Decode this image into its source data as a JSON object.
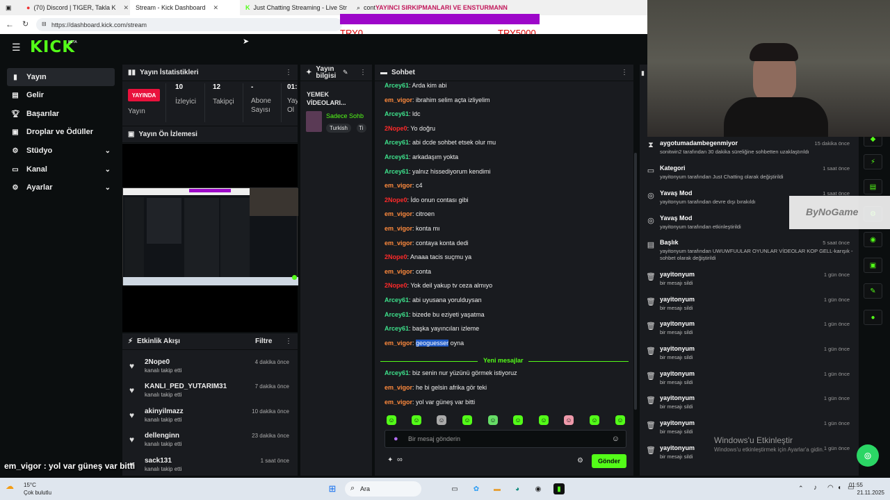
{
  "browser": {
    "tabs": [
      {
        "label": "(70) Discord | TIGER, Takla K",
        "active": false
      },
      {
        "label": "Stream - Kick Dashboard",
        "active": true
      },
      {
        "label": "Just Chatting Streaming - Live Str",
        "active": false
      },
      {
        "label": "cont",
        "active": false
      }
    ],
    "url": "https://dashboard.kick.com/stream"
  },
  "overlay": {
    "title": "YAYINCI SIRKIPMANLARI VE ENSTURMANN",
    "min": "TRY0",
    "max": "TRY5000"
  },
  "header": {
    "logo": "KICK",
    "badge": "BETA"
  },
  "sidebar": {
    "items": [
      {
        "label": "Yayın",
        "icon": "broadcast-icon",
        "selected": true
      },
      {
        "label": "Gelir",
        "icon": "money-icon"
      },
      {
        "label": "Başarılar",
        "icon": "trophy-icon"
      },
      {
        "label": "Droplar ve Ödüller",
        "icon": "gift-icon"
      },
      {
        "label": "Stüdyo",
        "icon": "gear-icon",
        "expand": true
      },
      {
        "label": "Kanal",
        "icon": "channel-icon",
        "expand": true
      },
      {
        "label": "Ayarlar",
        "icon": "gear-icon",
        "expand": true
      }
    ]
  },
  "stats": {
    "title": "Yayın İstatistikleri",
    "live_label": "YAYINDA",
    "live_sub": "Yayın",
    "items": [
      {
        "value": "10",
        "label": "İzleyici"
      },
      {
        "value": "12",
        "label": "Takipçi"
      },
      {
        "value": "-",
        "label": "Abone Sayısı"
      },
      {
        "value": "01:",
        "label": "Yay Ol"
      }
    ]
  },
  "preview": {
    "title": "Yayın Ön İzlemesi"
  },
  "streaminfo": {
    "title": "Yayın bilgisi",
    "stream_title": "YEMEK VİDEOLARI...",
    "category": "Sadece Sohb",
    "tags": [
      "Turkish",
      "Ti"
    ]
  },
  "activity": {
    "title": "Etkinlik Akışı",
    "filter": "Filtre",
    "items": [
      {
        "name": "2Nope0",
        "sub": "kanalı takip etti",
        "time": "4 dakika önce"
      },
      {
        "name": "KANLI_PED_YUTARIM31",
        "sub": "kanalı takip etti",
        "time": "7 dakika önce"
      },
      {
        "name": "akinyilmazz",
        "sub": "kanalı takip etti",
        "time": "10 dakika önce"
      },
      {
        "name": "dellenginn",
        "sub": "kanalı takip etti",
        "time": "23 dakika önce"
      },
      {
        "name": "sack131",
        "sub": "kanalı takip etti",
        "time": "1 saat önce"
      }
    ]
  },
  "chat": {
    "title": "Sohbet",
    "messages": [
      {
        "user": "Arcey61",
        "color": "green",
        "text": "Arda kim abi"
      },
      {
        "user": "em_vigor",
        "color": "orange",
        "text": "ibrahim selim açta izliyelim"
      },
      {
        "user": "Arcey61",
        "color": "green",
        "text": "ldc"
      },
      {
        "user": "2Nope0",
        "color": "red",
        "text": "Yo doğru"
      },
      {
        "user": "Arcey61",
        "color": "green",
        "text": "abi dcde sohbet etsek olur mu"
      },
      {
        "user": "Arcey61",
        "color": "green",
        "text": "arkadaşım yokta"
      },
      {
        "user": "Arcey61",
        "color": "green",
        "text": "yalnız hissediyorum kendimi"
      },
      {
        "user": "em_vigor",
        "color": "orange",
        "text": "c4"
      },
      {
        "user": "2Nope0",
        "color": "red",
        "text": "İdo onun contası gibi"
      },
      {
        "user": "em_vigor",
        "color": "orange",
        "text": "citroen"
      },
      {
        "user": "em_vigor",
        "color": "orange",
        "text": "konta mı"
      },
      {
        "user": "em_vigor",
        "color": "orange",
        "text": "contaya konta dedi"
      },
      {
        "user": "2Nope0",
        "color": "red",
        "text": "Anaaa tacis suçmu ya"
      },
      {
        "user": "em_vigor",
        "color": "orange",
        "text": "conta"
      },
      {
        "user": "2Nope0",
        "color": "red",
        "text": "Yok deil yakup tv ceza almıyo"
      },
      {
        "user": "Arcey61",
        "color": "green",
        "text": "abi uyusana yorulduysan"
      },
      {
        "user": "Arcey61",
        "color": "green",
        "text": "bizede bu eziyeti yaşatma"
      },
      {
        "user": "Arcey61",
        "color": "green",
        "text": "başka yayıncıları izleme"
      },
      {
        "user": "em_vigor",
        "color": "orange",
        "text": "oyna",
        "highlight": "geoguesser"
      }
    ],
    "new_label": "Yeni mesajlar",
    "new_messages": [
      {
        "user": "Arcey61",
        "color": "green",
        "text": "biz senin nur yüzünü görmek istiyoruz"
      },
      {
        "user": "em_vigor",
        "color": "orange",
        "text": "he bi gelsin afrika gör teki"
      },
      {
        "user": "em_vigor",
        "color": "orange",
        "text": "yol var güneş var bitti"
      }
    ],
    "placeholder": "Bir mesaj gönderin",
    "send": "Gönder",
    "infinity": "∞"
  },
  "modlog": [
    {
      "icon": "hourglass-icon",
      "name": "aygotumadambegenmiyor",
      "sub": "sonitwin2 tarafından 30 dakika süreliğine sohbetten uzaklaştırıldı",
      "time": "15 dakika önce"
    },
    {
      "icon": "category-icon",
      "name": "Kategori",
      "sub": "yayitonyum tarafından Just Chatting olarak değiştirildi",
      "time": "1 saat önce"
    },
    {
      "icon": "snail-icon",
      "name": "Yavaş Mod",
      "sub": "yayitonyum tarafından devre dışı bırakıldı",
      "time": "1 saat önce"
    },
    {
      "icon": "snail-icon",
      "name": "Yavaş Mod",
      "sub": "yayitonyum tarafından etkinleştirildi",
      "time": ""
    },
    {
      "icon": "title-icon",
      "name": "Başlık",
      "sub": "yayitonyum tarafından UWUWFUULAR OYUNLAR VİDEOLAR KOP GELL-karışık -sohbet olarak değiştirildi",
      "time": "5 saat önce"
    },
    {
      "icon": "trash-icon",
      "name": "yayitonyum",
      "sub": "bir mesajı sildi",
      "time": "1 gün önce"
    },
    {
      "icon": "trash-icon",
      "name": "yayitonyum",
      "sub": "bir mesajı sildi",
      "time": "1 gün önce"
    },
    {
      "icon": "trash-icon",
      "name": "yayitonyum",
      "sub": "bir mesajı sildi",
      "time": "1 gün önce"
    },
    {
      "icon": "trash-icon",
      "name": "yayitonyum",
      "sub": "bir mesajı sildi",
      "time": "1 gün önce"
    },
    {
      "icon": "trash-icon",
      "name": "yayitonyum",
      "sub": "bir mesajı sildi",
      "time": "1 gün önce"
    },
    {
      "icon": "trash-icon",
      "name": "yayitonyum",
      "sub": "bir mesajı sildi",
      "time": "1 gün önce"
    },
    {
      "icon": "trash-icon",
      "name": "yayitonyum",
      "sub": "bir mesajı sildi",
      "time": "1 gün önce"
    },
    {
      "icon": "trash-icon",
      "name": "yayitonyum",
      "sub": "bir mesajı sildi",
      "time": "1 gün önce"
    }
  ],
  "watermark": {
    "logo": "ByNoGame",
    "activate_title": "Windows'u Etkinleştir",
    "activate_sub": "Windows'u etkinleştirmek için Ayarlar'a gidin."
  },
  "caption": "em_vigor : yol var güneş var bitti",
  "taskbar": {
    "weather_temp": "15°C",
    "weather_desc": "Çok bulutlu",
    "search": "Ara",
    "time": "01:55",
    "date": "21.11.2025"
  },
  "colors": {
    "accent": "#53fc18",
    "live": "#e9113c",
    "bg": "#0b0e0f",
    "panel": "#191b1f"
  }
}
